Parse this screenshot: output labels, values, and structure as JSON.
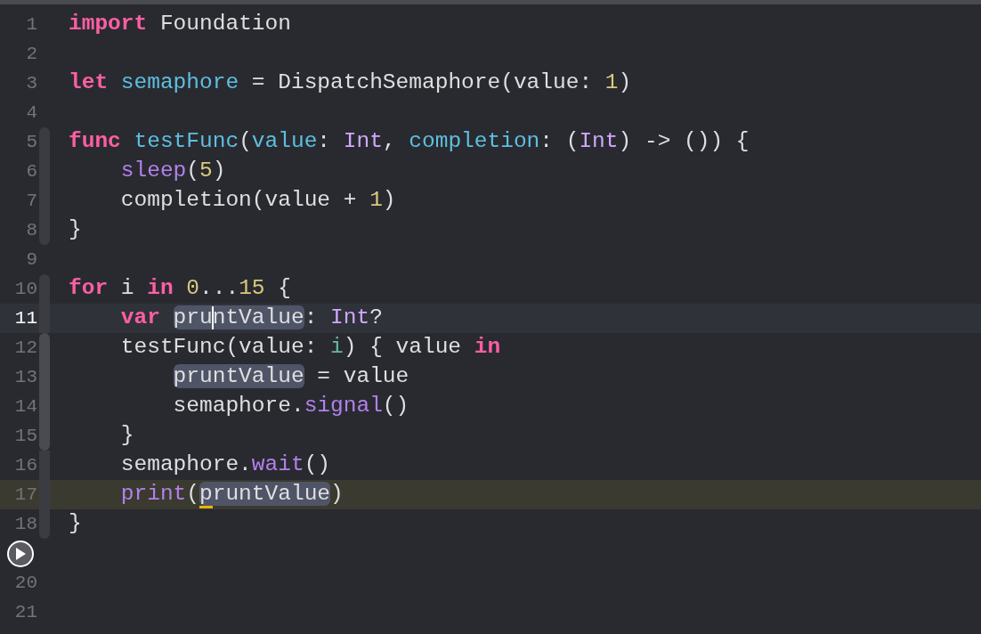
{
  "editor": {
    "lines": [
      {
        "number": "1",
        "current": false,
        "marked": false,
        "tokens": [
          {
            "kind": "keyword",
            "text": "import"
          },
          {
            "kind": "plain",
            "text": " Foundation"
          }
        ]
      },
      {
        "number": "2",
        "current": false,
        "marked": false
      },
      {
        "number": "3",
        "current": false,
        "marked": false,
        "tokens": [
          {
            "kind": "keyword",
            "text": "let "
          },
          {
            "kind": "decl",
            "text": "semaphore"
          },
          {
            "kind": "plain",
            "text": " = DispatchSemaphore(value: "
          },
          {
            "kind": "number",
            "text": "1"
          },
          {
            "kind": "plain",
            "text": ")"
          }
        ]
      },
      {
        "number": "4",
        "current": false,
        "marked": false
      },
      {
        "number": "5",
        "current": false,
        "marked": false,
        "tokens": [
          {
            "kind": "keyword",
            "text": "func "
          },
          {
            "kind": "decl",
            "text": "testFunc"
          },
          {
            "kind": "plain",
            "text": "("
          },
          {
            "kind": "decl",
            "text": "value"
          },
          {
            "kind": "plain",
            "text": ": "
          },
          {
            "kind": "type",
            "text": "Int"
          },
          {
            "kind": "plain",
            "text": ", "
          },
          {
            "kind": "decl",
            "text": "completion"
          },
          {
            "kind": "plain",
            "text": ": ("
          },
          {
            "kind": "type",
            "text": "Int"
          },
          {
            "kind": "plain",
            "text": ") -> ()) {"
          }
        ],
        "children": [
          {
            "number": "6",
            "current": false,
            "marked": false,
            "tokens": [
              {
                "kind": "call",
                "text": "sleep"
              },
              {
                "kind": "plain",
                "text": "("
              },
              {
                "kind": "number",
                "text": "5"
              },
              {
                "kind": "plain",
                "text": ")"
              }
            ]
          },
          {
            "number": "7",
            "current": false,
            "marked": false,
            "tokens": [
              {
                "kind": "plain",
                "text": "completion(value + "
              },
              {
                "kind": "number",
                "text": "1"
              },
              {
                "kind": "plain",
                "text": ")"
              }
            ]
          }
        ],
        "closing_line": {
          "number": "8",
          "current": false,
          "marked": false,
          "tokens": [
            {
              "kind": "plain",
              "text": "}"
            }
          ]
        }
      },
      {
        "number": "9",
        "current": false,
        "marked": false
      },
      {
        "number": "10",
        "current": false,
        "marked": false,
        "tokens": [
          {
            "kind": "keyword",
            "text": "for"
          },
          {
            "kind": "plain",
            "text": " i "
          },
          {
            "kind": "keyword",
            "text": "in "
          },
          {
            "kind": "number",
            "text": "0"
          },
          {
            "kind": "plain",
            "text": "..."
          },
          {
            "kind": "number",
            "text": "15"
          },
          {
            "kind": "plain",
            "text": " {"
          }
        ],
        "children": [
          {
            "number": "11",
            "current": true,
            "marked": false,
            "tokens": [
              {
                "kind": "keyword",
                "text": "var "
              },
              {
                "kind": "occurrence",
                "caret": true,
                "parts": [
                  {
                    "text": "pru",
                    "flagged": false
                  },
                  {
                    "text": "ntValue",
                    "flagged": false
                  }
                ]
              },
              {
                "kind": "plain",
                "text": ": "
              },
              {
                "kind": "type",
                "text": "Int"
              },
              {
                "kind": "plain",
                "text": "?"
              }
            ]
          },
          {
            "number": "12",
            "current": false,
            "marked": false,
            "tokens": [
              {
                "kind": "plain",
                "text": "testFunc(value: "
              },
              {
                "kind": "param",
                "text": "i"
              },
              {
                "kind": "plain",
                "text": ") { value "
              },
              {
                "kind": "keyword",
                "text": "in"
              }
            ],
            "children": [
              {
                "number": "13",
                "current": false,
                "marked": false,
                "tokens": [
                  {
                    "kind": "occurrence",
                    "caret": false,
                    "parts": [
                      {
                        "text": "pruntValue",
                        "flagged": false
                      }
                    ]
                  },
                  {
                    "kind": "plain",
                    "text": " = value"
                  }
                ]
              },
              {
                "number": "14",
                "current": false,
                "marked": false,
                "tokens": [
                  {
                    "kind": "plain",
                    "text": "semaphore."
                  },
                  {
                    "kind": "call",
                    "text": "signal"
                  },
                  {
                    "kind": "plain",
                    "text": "()"
                  }
                ]
              }
            ],
            "closing_line": {
              "number": "15",
              "current": false,
              "marked": false,
              "tokens": [
                {
                  "kind": "plain",
                  "text": "}"
                }
              ]
            }
          },
          {
            "number": "16",
            "current": false,
            "marked": false,
            "tokens": [
              {
                "kind": "plain",
                "text": "semaphore."
              },
              {
                "kind": "call",
                "text": "wait"
              },
              {
                "kind": "plain",
                "text": "()"
              }
            ]
          },
          {
            "number": "17",
            "current": false,
            "marked": true,
            "tokens": [
              {
                "kind": "call",
                "text": "print"
              },
              {
                "kind": "plain",
                "text": "("
              },
              {
                "kind": "occurrence",
                "caret": false,
                "parts": [
                  {
                    "text": "p",
                    "flagged": true
                  },
                  {
                    "text": "runtValue",
                    "flagged": false
                  }
                ]
              },
              {
                "kind": "plain",
                "text": ")"
              }
            ]
          }
        ],
        "closing_line": {
          "number": "18",
          "current": false,
          "marked": false,
          "tokens": [
            {
              "kind": "plain",
              "text": "}"
            }
          ]
        }
      },
      {
        "run_button": true,
        "current": false,
        "marked": false
      },
      {
        "number": "20",
        "current": false,
        "marked": false
      },
      {
        "number": "21",
        "current": false,
        "marked": false
      }
    ]
  }
}
